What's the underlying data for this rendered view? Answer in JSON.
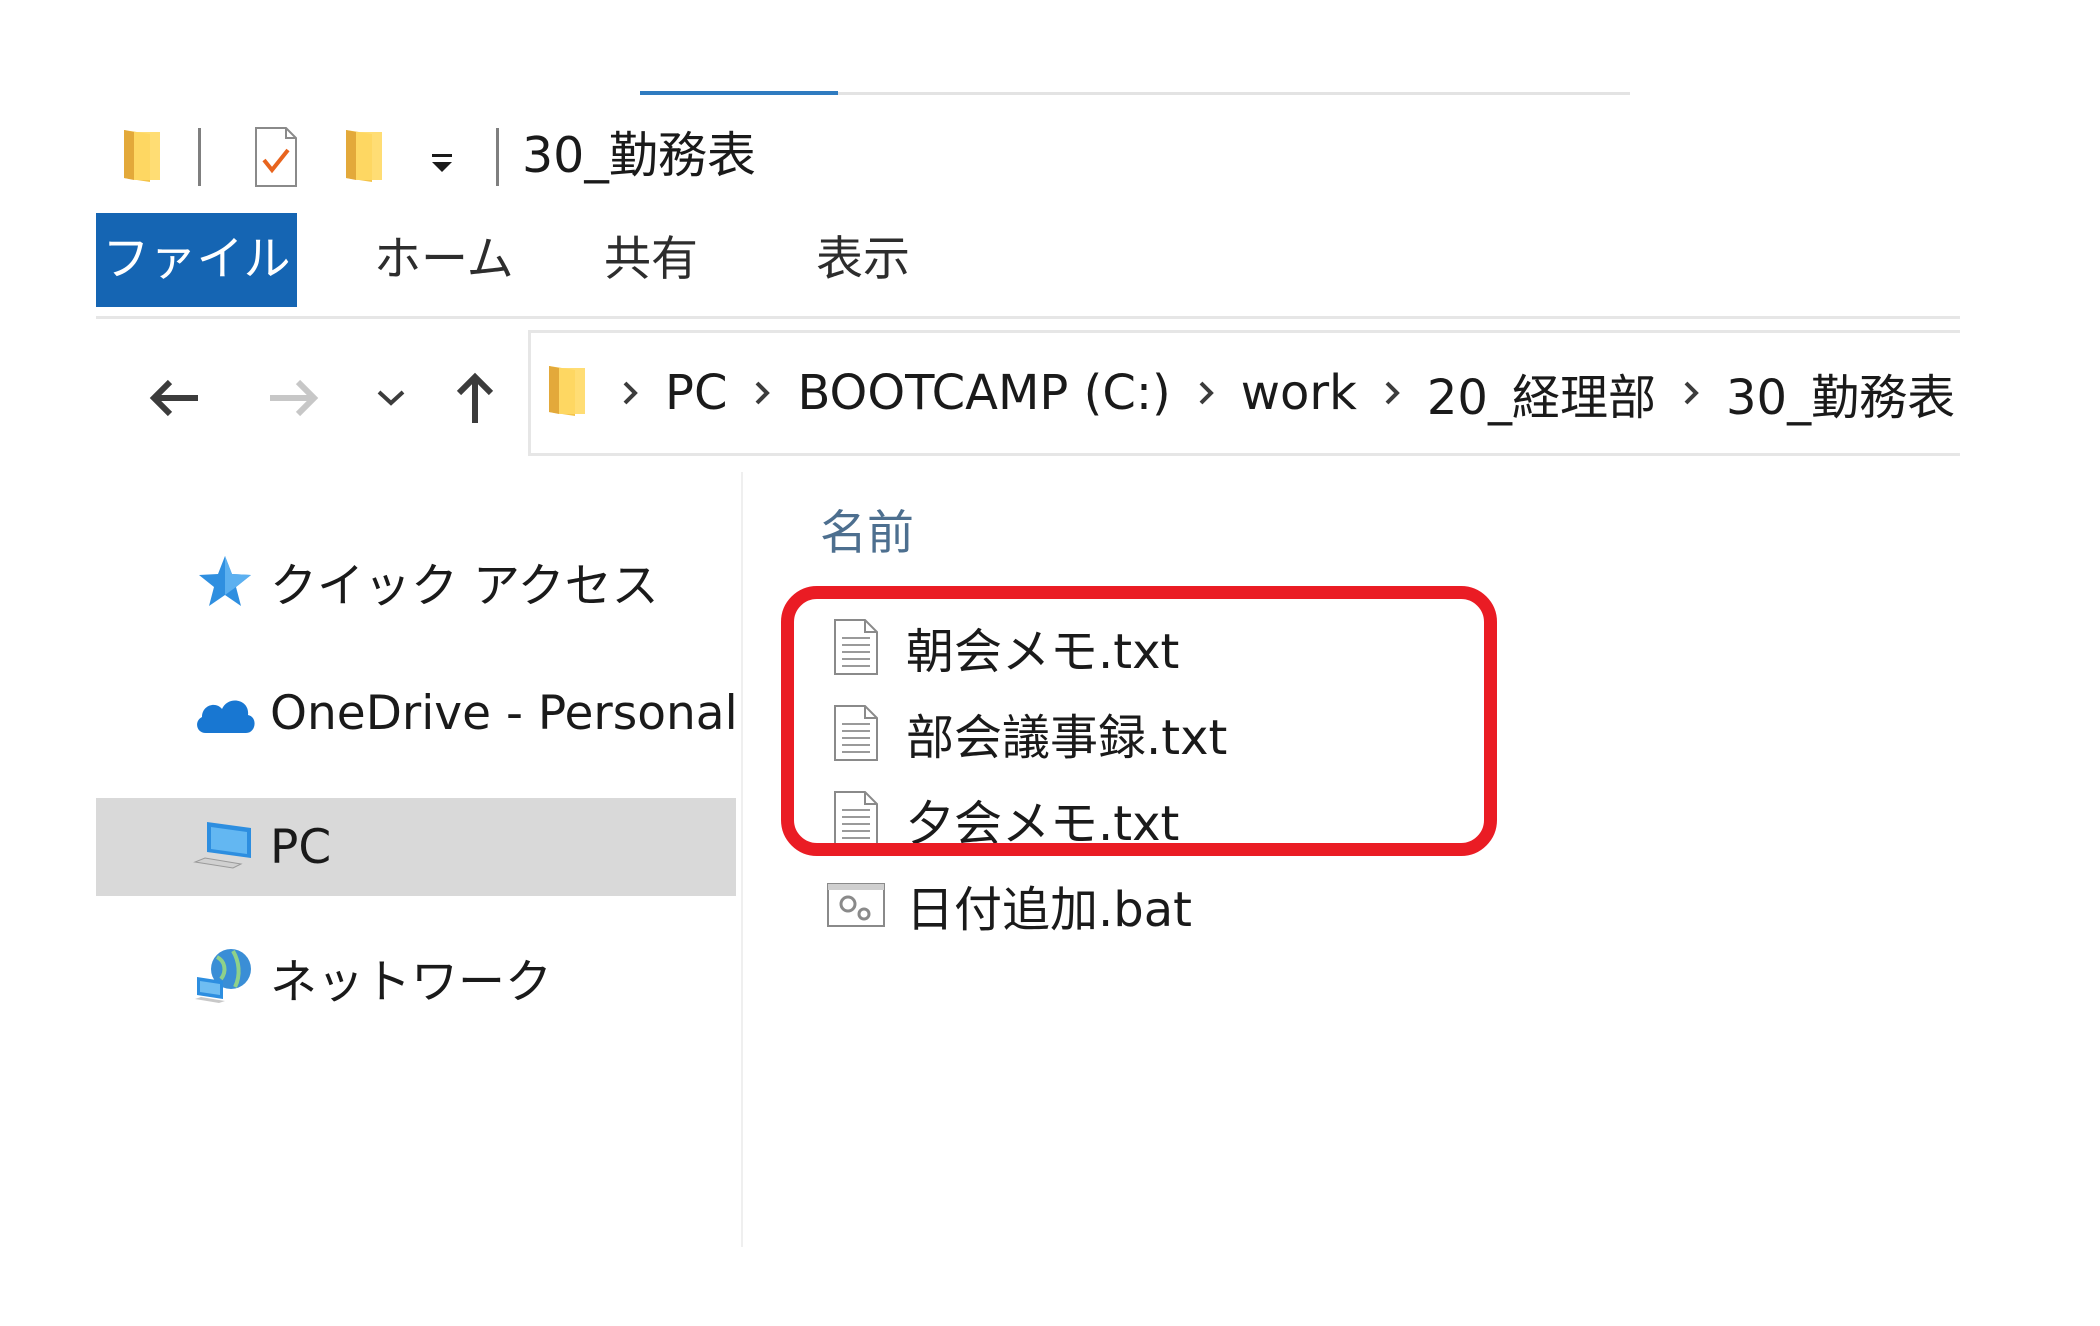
{
  "window": {
    "title": "30_勤務表"
  },
  "quick_access_toolbar": {
    "icons": [
      "folder-icon",
      "properties-checkmark-icon",
      "new-folder-icon",
      "customize-dropdown-icon"
    ]
  },
  "ribbon": {
    "tabs": [
      {
        "label": "ファイル",
        "active": true
      },
      {
        "label": "ホーム"
      },
      {
        "label": "共有"
      },
      {
        "label": "表示"
      }
    ],
    "accent_color": "#1565b3"
  },
  "navigation": {
    "back_icon": "arrow-left-icon",
    "forward_icon": "arrow-right-icon",
    "recent_icon": "chevron-down-icon",
    "up_icon": "arrow-up-icon"
  },
  "address_bar": {
    "crumbs": [
      "PC",
      "BOOTCAMP (C:)",
      "work",
      "20_経理部",
      "30_勤務表"
    ]
  },
  "nav_pane": {
    "items": [
      {
        "label": "クイック アクセス",
        "icon": "star-icon"
      },
      {
        "label": "OneDrive - Personal",
        "icon": "cloud-icon"
      },
      {
        "label": "PC",
        "icon": "computer-icon",
        "selected": true
      },
      {
        "label": "ネットワーク",
        "icon": "network-icon"
      }
    ]
  },
  "file_list": {
    "column_header": "名前",
    "files": [
      {
        "name": "朝会メモ.txt",
        "icon": "text-file-icon"
      },
      {
        "name": "部会議事録.txt",
        "icon": "text-file-icon"
      },
      {
        "name": "夕会メモ.txt",
        "icon": "text-file-icon"
      },
      {
        "name": "日付追加.bat",
        "icon": "batch-file-icon"
      }
    ]
  },
  "annotation": {
    "highlight_color": "#ea1c24"
  }
}
